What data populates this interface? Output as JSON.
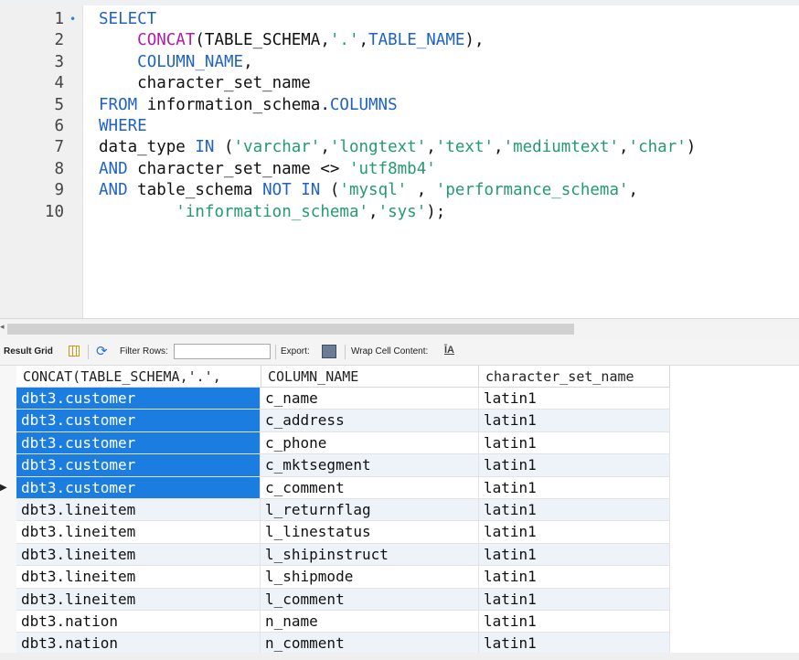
{
  "editor": {
    "lines": [
      {
        "num": "1",
        "marker": "•",
        "segments": [
          {
            "t": "SELECT",
            "c": "kw"
          }
        ]
      },
      {
        "num": "2",
        "marker": "",
        "segments": [
          {
            "t": "    ",
            "c": "txt"
          },
          {
            "t": "CONCAT",
            "c": "fn"
          },
          {
            "t": "(TABLE_SCHEMA,",
            "c": "txt"
          },
          {
            "t": "'.'",
            "c": "str"
          },
          {
            "t": ",",
            "c": "txt"
          },
          {
            "t": "TABLE_NAME",
            "c": "kw"
          },
          {
            "t": "),",
            "c": "txt"
          }
        ]
      },
      {
        "num": "3",
        "marker": "",
        "segments": [
          {
            "t": "    ",
            "c": "txt"
          },
          {
            "t": "COLUMN_NAME",
            "c": "kw"
          },
          {
            "t": ",",
            "c": "txt"
          }
        ]
      },
      {
        "num": "4",
        "marker": "",
        "segments": [
          {
            "t": "    character_set_name",
            "c": "txt"
          }
        ]
      },
      {
        "num": "5",
        "marker": "",
        "segments": [
          {
            "t": "FROM",
            "c": "kw"
          },
          {
            "t": " information_schema.",
            "c": "txt"
          },
          {
            "t": "COLUMNS",
            "c": "kw"
          }
        ]
      },
      {
        "num": "6",
        "marker": "",
        "segments": [
          {
            "t": "WHERE",
            "c": "kw"
          }
        ]
      },
      {
        "num": "7",
        "marker": "",
        "segments": [
          {
            "t": "data_type ",
            "c": "txt"
          },
          {
            "t": "IN",
            "c": "kw"
          },
          {
            "t": " (",
            "c": "txt"
          },
          {
            "t": "'varchar'",
            "c": "str"
          },
          {
            "t": ",",
            "c": "txt"
          },
          {
            "t": "'longtext'",
            "c": "str"
          },
          {
            "t": ",",
            "c": "txt"
          },
          {
            "t": "'text'",
            "c": "str"
          },
          {
            "t": ",",
            "c": "txt"
          },
          {
            "t": "'mediumtext'",
            "c": "str"
          },
          {
            "t": ",",
            "c": "txt"
          },
          {
            "t": "'char'",
            "c": "str"
          },
          {
            "t": ")",
            "c": "txt"
          }
        ]
      },
      {
        "num": "8",
        "marker": "",
        "segments": [
          {
            "t": "AND",
            "c": "kw"
          },
          {
            "t": " character_set_name <> ",
            "c": "txt"
          },
          {
            "t": "'utf8mb4'",
            "c": "str"
          }
        ]
      },
      {
        "num": "9",
        "marker": "",
        "segments": [
          {
            "t": "AND",
            "c": "kw"
          },
          {
            "t": " table_schema ",
            "c": "txt"
          },
          {
            "t": "NOT IN",
            "c": "kw"
          },
          {
            "t": " (",
            "c": "txt"
          },
          {
            "t": "'mysql'",
            "c": "str"
          },
          {
            "t": " , ",
            "c": "txt"
          },
          {
            "t": "'performance_schema'",
            "c": "str"
          },
          {
            "t": ",",
            "c": "txt"
          }
        ]
      },
      {
        "num": "10",
        "marker": "",
        "segments": [
          {
            "t": "        ",
            "c": "txt"
          },
          {
            "t": "'information_schema'",
            "c": "str"
          },
          {
            "t": ",",
            "c": "txt"
          },
          {
            "t": "'sys'",
            "c": "str"
          },
          {
            "t": ");",
            "c": "txt"
          }
        ]
      }
    ]
  },
  "result_toolbar": {
    "result_grid_label": "Result Grid",
    "filter_rows_label": "Filter Rows:",
    "filter_rows_value": "",
    "export_label": "Export:",
    "wrap_label": "Wrap Cell Content:",
    "wrap_icon": "ĪA"
  },
  "grid": {
    "columns": [
      "CONCAT(TABLE_SCHEMA,'.',",
      "COLUMN_NAME",
      "character_set_name"
    ],
    "rows": [
      {
        "c1": "dbt3.customer",
        "c2": "c_name",
        "c3": "latin1",
        "selected": true,
        "alt": false,
        "pointer": false
      },
      {
        "c1": "dbt3.customer",
        "c2": "c_address",
        "c3": "latin1",
        "selected": true,
        "alt": true,
        "pointer": false
      },
      {
        "c1": "dbt3.customer",
        "c2": "c_phone",
        "c3": "latin1",
        "selected": true,
        "alt": false,
        "pointer": false
      },
      {
        "c1": "dbt3.customer",
        "c2": "c_mktsegment",
        "c3": "latin1",
        "selected": true,
        "alt": true,
        "pointer": false
      },
      {
        "c1": "dbt3.customer",
        "c2": "c_comment",
        "c3": "latin1",
        "selected": true,
        "alt": false,
        "pointer": true
      },
      {
        "c1": "dbt3.lineitem",
        "c2": "l_returnflag",
        "c3": "latin1",
        "selected": false,
        "alt": true,
        "pointer": false
      },
      {
        "c1": "dbt3.lineitem",
        "c2": "l_linestatus",
        "c3": "latin1",
        "selected": false,
        "alt": false,
        "pointer": false
      },
      {
        "c1": "dbt3.lineitem",
        "c2": "l_shipinstruct",
        "c3": "latin1",
        "selected": false,
        "alt": true,
        "pointer": false
      },
      {
        "c1": "dbt3.lineitem",
        "c2": "l_shipmode",
        "c3": "latin1",
        "selected": false,
        "alt": false,
        "pointer": false
      },
      {
        "c1": "dbt3.lineitem",
        "c2": "l_comment",
        "c3": "latin1",
        "selected": false,
        "alt": true,
        "pointer": false
      },
      {
        "c1": "dbt3.nation",
        "c2": "n_name",
        "c3": "latin1",
        "selected": false,
        "alt": false,
        "pointer": false
      },
      {
        "c1": "dbt3.nation",
        "c2": "n_comment",
        "c3": "latin1",
        "selected": false,
        "alt": true,
        "pointer": false
      }
    ]
  },
  "colors": {
    "keyword": "#1e62c8",
    "function": "#b41aa8",
    "string": "#239b6f",
    "selection": "#1c7de0"
  }
}
